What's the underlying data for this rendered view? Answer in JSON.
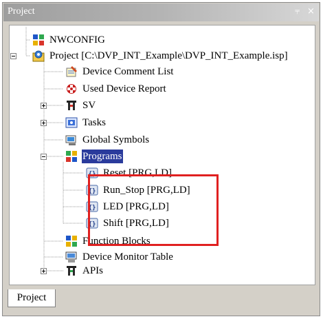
{
  "window": {
    "title": "Project",
    "pin_glyph": "⫧",
    "close_glyph": "×"
  },
  "tree": {
    "nodes": [
      {
        "label": "NWCONFIG",
        "icon": "nwconfig-icon"
      },
      {
        "label": "Project [C:\\DVP_INT_Example\\DVP_INT_Example.isp]",
        "icon": "project-icon",
        "expanded": true
      },
      {
        "label": "Device Comment List",
        "icon": "comment-list-icon"
      },
      {
        "label": "Used Device Report",
        "icon": "device-report-icon"
      },
      {
        "label": "SV",
        "icon": "sv-icon",
        "expanded": false
      },
      {
        "label": "Tasks",
        "icon": "tasks-icon",
        "expanded": false
      },
      {
        "label": "Global Symbols",
        "icon": "global-symbols-icon"
      },
      {
        "label": "Programs",
        "icon": "programs-icon",
        "expanded": true,
        "selected": true
      },
      {
        "label": "Reset [PRG,LD]",
        "icon": "program-icon"
      },
      {
        "label": "Run_Stop [PRG,LD]",
        "icon": "program-icon"
      },
      {
        "label": "LED [PRG,LD]",
        "icon": "program-icon"
      },
      {
        "label": "Shift [PRG,LD]",
        "icon": "program-icon"
      },
      {
        "label": "Function Blocks",
        "icon": "function-blocks-icon"
      },
      {
        "label": "Device Monitor Table",
        "icon": "monitor-table-icon"
      },
      {
        "label": "APIs",
        "icon": "apis-icon",
        "expanded": false
      }
    ]
  },
  "tabs": [
    {
      "label": "Project",
      "active": true
    }
  ],
  "colors": {
    "highlight_border": "#e02020",
    "selection_bg": "#2a3b9c"
  }
}
